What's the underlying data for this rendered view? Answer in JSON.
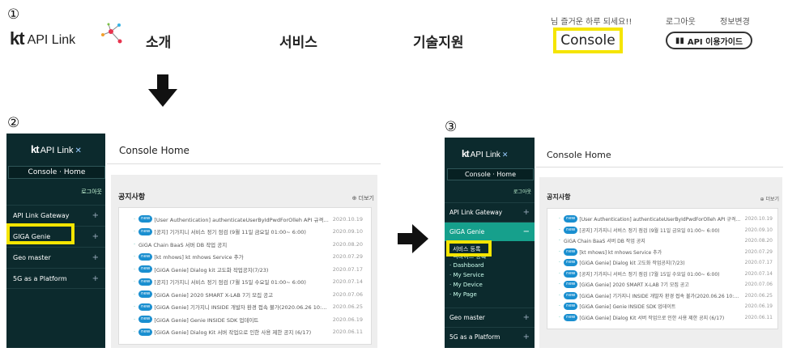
{
  "steps": [
    "①",
    "②",
    "③"
  ],
  "logo": {
    "kt": "kt",
    "api": "API Link"
  },
  "top_nav": {
    "items": [
      "소개",
      "서비스",
      "기술지원"
    ],
    "console": "Console",
    "greeting": "님 즐거운 하루 되세요!!",
    "logout": "로그아웃",
    "info_change": "정보변경",
    "guide": "API 이용가이드"
  },
  "panel2": {
    "console_home_label": "Console · Home",
    "logout": "로그아웃",
    "menu": [
      "API Link Gateway",
      "GIGA Genie",
      "Geo master",
      "5G as a Platform"
    ],
    "title": "Console Home",
    "notice_title": "공지사항",
    "more": "더보기"
  },
  "panel3": {
    "console_home_label": "Console · Home",
    "logout": "로그아웃",
    "menu": [
      "API Link Gateway",
      "GIGA Genie",
      "Geo master",
      "5G as a Platform"
    ],
    "submenu": [
      "서비스 등록",
      "디바이스 등록",
      "Dashboard",
      "My Service",
      "My Device",
      "My Page"
    ],
    "title": "Console Home",
    "notice_title": "공지사항",
    "more": "더보기"
  },
  "notices": [
    {
      "new": true,
      "text": "[User Authentication] authenticateUserByIdPwdForOlleh API 규격 종···",
      "date": "2020.10.19"
    },
    {
      "new": true,
      "text": "[공지] 기가지니 서비스 정기 점검 (9월 11일 금요일 01:00~ 6:00)",
      "date": "2020.09.10"
    },
    {
      "new": false,
      "text": "GiGA Chain BaaS 서버 DB 작업 공지",
      "date": "2020.08.20"
    },
    {
      "new": true,
      "text": "[kt mhows] kt mhows Service 추가",
      "date": "2020.07.29"
    },
    {
      "new": true,
      "text": "[GiGA Genie] Dialog kit 고도화 작업공지(7/23)",
      "date": "2020.07.17"
    },
    {
      "new": true,
      "text": "[공지] 기가지니 서비스 정기 점검 (7월 15일 수요일 01:00~ 6:00)",
      "date": "2020.07.14"
    },
    {
      "new": true,
      "text": "[GiGA Genie] 2020 SMART X-LAB 7기 모집 공고",
      "date": "2020.07.06"
    },
    {
      "new": true,
      "text": "[GiGA Genie] 기가지니 INSIDE 개발자 환경 접속 불가(2020.06.26 10:0···",
      "date": "2020.06.25"
    },
    {
      "new": true,
      "text": "[GiGA Genie] Genie INSIDE SDK 업데이트",
      "date": "2020.06.19"
    },
    {
      "new": true,
      "text": "[GiGA Genie] Dialog Kit 서버 작업으로 인한 사용 제한 공지 (6/17)",
      "date": "2020.06.11"
    }
  ],
  "badge_label": "new",
  "colors": {
    "highlight": "#f5e500",
    "sidebar": "#0c2a2d",
    "active_menu": "#16a08c",
    "badge": "#1a8fd0"
  }
}
